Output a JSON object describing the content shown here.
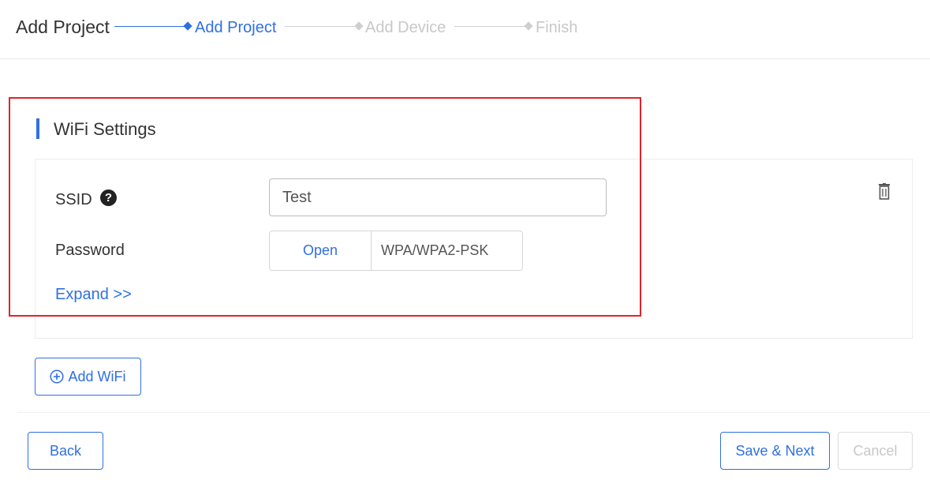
{
  "header": {
    "title": "Add Project",
    "steps": [
      {
        "label": "Add Project",
        "state": "active"
      },
      {
        "label": "Add Device",
        "state": "inactive"
      },
      {
        "label": "Finish",
        "state": "inactive"
      }
    ]
  },
  "wifi_settings": {
    "section_title": "WiFi Settings",
    "ssid": {
      "label": "SSID",
      "value": "Test",
      "help_icon": "question-circle-icon"
    },
    "password": {
      "label": "Password",
      "options": [
        "Open",
        "WPA/WPA2-PSK"
      ],
      "selected": "Open"
    },
    "expand_label": "Expand >>",
    "delete_icon": "trash-icon"
  },
  "add_wifi": {
    "label": "Add WiFi",
    "icon": "plus-circle-icon"
  },
  "footer": {
    "back_label": "Back",
    "save_next_label": "Save & Next",
    "cancel_label": "Cancel"
  },
  "colors": {
    "accent": "#2f6fe4",
    "highlight": "#e0242a",
    "disabled": "#c8c8c8"
  }
}
